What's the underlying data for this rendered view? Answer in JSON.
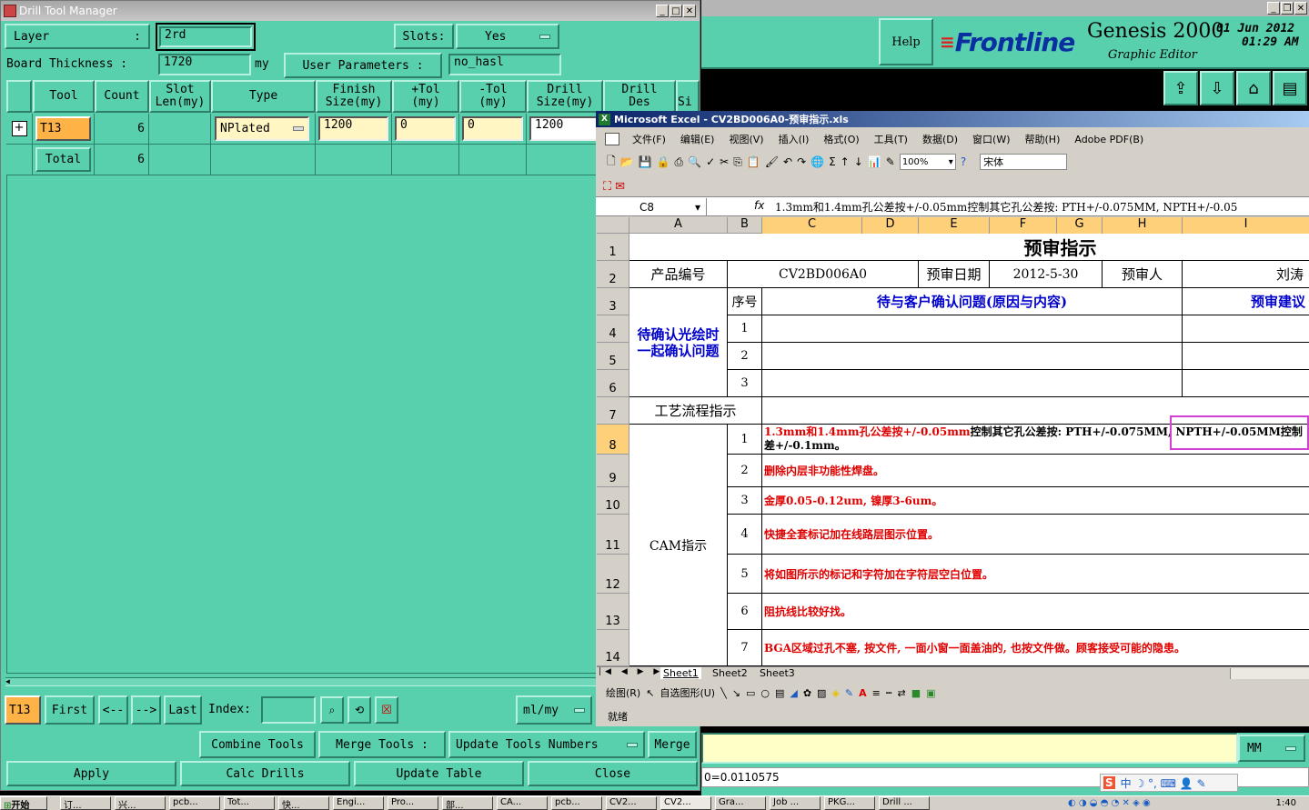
{
  "drill_window": {
    "title": "Drill Tool Manager",
    "layer_label": "Layer",
    "layer_colon": ":",
    "layer_value": "2rd",
    "slots_label": "Slots:",
    "slots_value": "Yes",
    "board_thickness_label": "Board Thickness :",
    "board_thickness_value": "1720",
    "board_thickness_unit": "my",
    "user_params_label": "User Parameters :",
    "user_params_value": "no_hasl",
    "columns": [
      "Tool",
      "Count",
      "Slot\nLen(my)",
      "Type",
      "Finish\nSize(my)",
      "+Tol\n(my)",
      "-Tol\n(my)",
      "Drill\nSize(my)",
      "Drill\nDes",
      "Si"
    ],
    "row": {
      "tool": "T13",
      "count": "6",
      "type": "NPlated",
      "finish": "1200",
      "ptol": "0",
      "ntol": "0",
      "drill": "1200"
    },
    "total_label": "Total",
    "total_count": "6",
    "nav": {
      "current": "T13",
      "first": "First",
      "prev": "<--",
      "next": "-->",
      "last": "Last",
      "index_label": "Index:",
      "unit": "ml/my"
    },
    "buttons": {
      "combine": "Combine Tools",
      "merge_label": "Merge Tools :",
      "update_numbers": "Update Tools Numbers",
      "merge": "Merge",
      "apply": "Apply",
      "calc": "Calc Drills",
      "update_table": "Update Table",
      "close": "Close"
    }
  },
  "genesis": {
    "help": "Help",
    "logo": "Frontline",
    "product": "Genesis 2000",
    "subtitle": "Graphic Editor",
    "date": "01 Jun 2012",
    "time": "01:29 AM",
    "unit_select": "MM",
    "status_value": "0=0.0110575"
  },
  "excel": {
    "title": "Microsoft Excel - CV2BD006A0-预审指示.xls",
    "menu": [
      "文件(F)",
      "编辑(E)",
      "视图(V)",
      "插入(I)",
      "格式(O)",
      "工具(T)",
      "数据(D)",
      "窗口(W)",
      "帮助(H)",
      "Adobe PDF(B)"
    ],
    "zoom": "100%",
    "font": "宋体",
    "name_box": "C8",
    "formula": "1.3mm和1.4mm孔公差按+/-0.05mm控制其它孔公差按: PTH+/-0.075MM, NPTH+/-0.05",
    "col_headers": [
      "A",
      "B",
      "C",
      "D",
      "E",
      "F",
      "G",
      "H",
      "I"
    ],
    "row_headers": [
      "1",
      "2",
      "3",
      "4",
      "5",
      "6",
      "7",
      "8",
      "9",
      "10",
      "11",
      "12",
      "13",
      "14"
    ],
    "sheet_title": "预审指示",
    "product_no_label": "产品编号",
    "product_no": "CV2BD006A0",
    "review_date_label": "预审日期",
    "review_date": "2012-5-30",
    "reviewer_label": "预审人",
    "reviewer": "刘涛",
    "seq_label": "序号",
    "confirm_header": "待与客户确认问题(原因与内容)",
    "suggest_header": "预审建议",
    "confirm_group": "待确认光绘时一起确认问题",
    "confirm_nums": [
      "1",
      "2",
      "3"
    ],
    "process_label": "工艺流程指示",
    "cam_label": "CAM指示",
    "cam_items": [
      {
        "n": "1",
        "text": "1.3mm和1.4mm孔公差按+/-0.05mm",
        "text2": "控制其它孔公差按: PTH+/-0.075MM, NPTH+/-0.05MM控制",
        "text3": "差+/-0.1mm。"
      },
      {
        "n": "2",
        "text": "删除内层非功能性焊盘。"
      },
      {
        "n": "3",
        "text": "金厚0.05-0.12um, 镍厚3-6um。"
      },
      {
        "n": "4",
        "text": "快捷全套标记加在线路层图示位置。"
      },
      {
        "n": "5",
        "text": "将如图所示的标记和字符加在字符层空白位置。"
      },
      {
        "n": "6",
        "text": "阻抗线比较好找。"
      },
      {
        "n": "7",
        "text": "BGA区域过孔不塞, 按文件, 一面小窗一面盖油的, 也按文件做。顾客接受可能的隐患。"
      }
    ],
    "sheets": [
      "Sheet1",
      "Sheet2",
      "Sheet3"
    ],
    "draw_label": "绘图(R)",
    "autoshape_label": "自选图形(U)",
    "status": "就绪"
  },
  "taskbar": {
    "start": "开始",
    "items": [
      "订...",
      "兴...",
      "pcb...",
      "Tot...",
      "快...",
      "Engi...",
      "Pro...",
      "部...",
      "CA...",
      "pcb...",
      "CV2...",
      "CV2...",
      "Gra...",
      "Job ...",
      "PKG...",
      "Drill ..."
    ],
    "clock": "1:40"
  },
  "colors": {
    "panel": "#58cfad",
    "excel_title": "#0a246a",
    "red": "#e00000",
    "blue": "#0000cc"
  }
}
